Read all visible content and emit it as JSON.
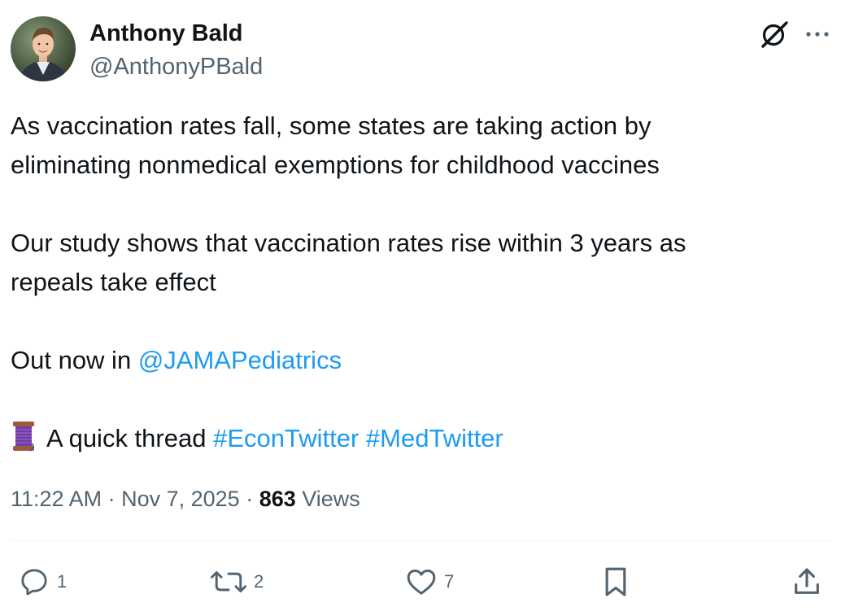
{
  "author": {
    "name": "Anthony Bald",
    "handle": "@AnthonyPBald"
  },
  "tweet": {
    "line1": "As vaccination rates fall, some states are taking action by",
    "line2": "eliminating nonmedical exemptions for childhood vaccines",
    "line3": "Our study shows that vaccination rates rise within 3 years as",
    "line4": "repeals take effect",
    "out_now_text": "Out now in ",
    "mention": "@JAMAPediatrics",
    "thread_emoji": "spool-of-thread-icon",
    "thread_text": "A quick thread ",
    "hashtag1": "#EconTwitter",
    "hashtag2": "#MedTwitter"
  },
  "meta": {
    "time": "11:22 AM",
    "separator": " · ",
    "date": "Nov 7, 2025",
    "views_count": "863",
    "views_label": " Views"
  },
  "actions": {
    "replies": "1",
    "reposts": "2",
    "likes": "7"
  },
  "colors": {
    "link": "#1d9bf0",
    "secondary_text": "#536471",
    "primary_text": "#0f1419",
    "divider": "#eff3f4"
  }
}
